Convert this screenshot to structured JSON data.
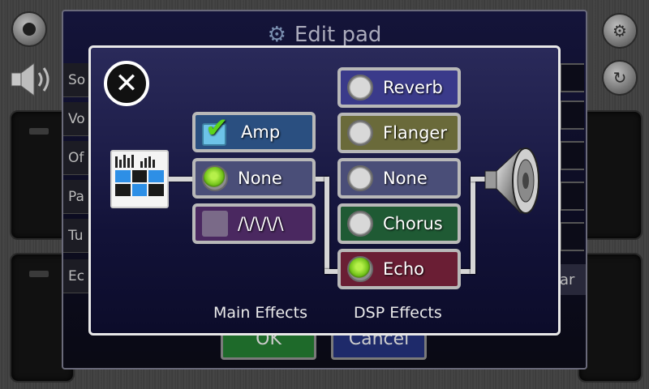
{
  "background": {
    "edit_pad_title": "Edit pad",
    "side_rows": [
      "So",
      "Vo",
      "Of",
      "Pa",
      "Tu",
      "Ec"
    ],
    "right_edge_text": "ar",
    "ok_label": "OK",
    "cancel_label": "Cancel"
  },
  "effects_dialog": {
    "main_effects": [
      {
        "label": "Amp",
        "control": "checkbox",
        "checked": true,
        "color": "#2a4f80"
      },
      {
        "label": "None",
        "control": "radio",
        "checked": true,
        "color": "#4a4e78"
      },
      {
        "label": "/\\/\\/\\/\\",
        "control": "checkbox",
        "checked": false,
        "color": "#4a2860"
      }
    ],
    "dsp_effects": [
      {
        "label": "Reverb",
        "checked": false,
        "color": "#3a3a8a"
      },
      {
        "label": "Flanger",
        "checked": false,
        "color": "#6a6a3a"
      },
      {
        "label": "None",
        "checked": false,
        "color": "#4a4e78"
      },
      {
        "label": "Chorus",
        "checked": false,
        "color": "#1f5a34"
      },
      {
        "label": "Echo",
        "checked": true,
        "color": "#6a1e34"
      }
    ],
    "main_caption": "Main Effects",
    "dsp_caption": "DSP Effects",
    "close_symbol": "✕"
  }
}
